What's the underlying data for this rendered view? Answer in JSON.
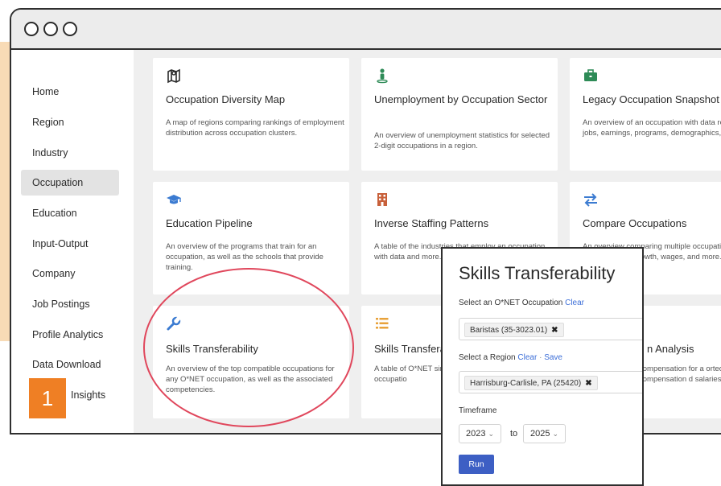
{
  "window": {
    "controls": [
      "close",
      "minimize",
      "maximize"
    ]
  },
  "badge": {
    "label": "1",
    "color": "#ef7f24"
  },
  "sidebar": {
    "active": "Occupation",
    "items": [
      {
        "label": "Home"
      },
      {
        "label": "Region"
      },
      {
        "label": "Industry"
      },
      {
        "label": "Occupation"
      },
      {
        "label": "Education"
      },
      {
        "label": "Input-Output"
      },
      {
        "label": "Company"
      },
      {
        "label": "Job Postings"
      },
      {
        "label": "Profile Analytics"
      },
      {
        "label": "Data Download"
      },
      {
        "label": "Insights",
        "partial_prefix_hidden": true
      }
    ]
  },
  "cards": [
    {
      "icon": "map-icon",
      "title": "Occupation Diversity Map",
      "desc": "A map of regions comparing rankings of employment distribution across occupation clusters."
    },
    {
      "icon": "person-pin-icon",
      "title": "Unemployment by Occupation Sector",
      "desc": "An overview of unemployment statistics for selected 2-digit occupations in a region."
    },
    {
      "icon": "briefcase-icon",
      "title": "Legacy Occupation Snapshot",
      "desc": "An overview of an occupation with data related to jobs, earnings, programs, demographics, and more."
    },
    {
      "icon": "graduation-cap-icon",
      "title": "Education Pipeline",
      "desc": "An overview of the programs that train for an occupation, as well as the schools that provide training."
    },
    {
      "icon": "building-icon",
      "title": "Inverse Staffing Patterns",
      "desc": "A table of the industries that employ an occupation with data and more."
    },
    {
      "icon": "arrows-exchange-icon",
      "title": "Compare Occupations",
      "desc": "An overview comparing multiple occupations with data related to growth, wages, and more."
    },
    {
      "icon": "wrench-icon",
      "title": "Skills Transferability",
      "desc": "An overview of the top compatible occupations for any O*NET occupation, as well as the associated competencies."
    },
    {
      "icon": "list-icon",
      "title": "Skills Transfera",
      "desc": "A table of O*NET similar knowledge, selected occupatio"
    },
    {
      "icon": "",
      "title": "n Analysis",
      "desc": "compensation for a orted compensation d salaries being offe"
    }
  ],
  "popup": {
    "title": "Skills Transferability",
    "occupation_label": "Select an O*NET Occupation",
    "occupation_clear": "Clear",
    "occupation_chip": "Baristas (35-3023.01)",
    "region_label": "Select a Region",
    "region_clear": "Clear",
    "region_sep": "·",
    "region_save": "Save",
    "region_chip": "Harrisburg-Carlisle, PA (25420)",
    "timeframe_label": "Timeframe",
    "timeframe_from": "2023",
    "timeframe_to_word": "to",
    "timeframe_to": "2025",
    "run_label": "Run"
  },
  "colors": {
    "accent_blue": "#3d6fd8",
    "run_button": "#3d5fc4",
    "highlight_oval": "#e0475c",
    "icon_teal": "#3b7bd1",
    "icon_green": "#2e8b57"
  }
}
